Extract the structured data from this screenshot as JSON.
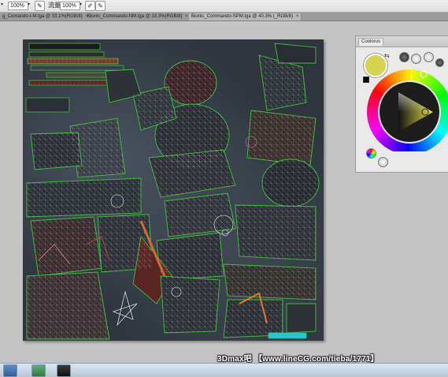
{
  "options_bar": {
    "zoom_value_1": "100%",
    "flow_label": "流量:",
    "zoom_value_2": "100%"
  },
  "doc_tabs": [
    {
      "label": "g_Comando-I-M.tga @ 33.1%(RGB/8)",
      "close": "×"
    },
    {
      "label": "Bionic_Commando-NM.tga @ 33.3%(RGB/8)",
      "close": "×"
    },
    {
      "label": "Bionic_Commando-SPM.tga @ 40.3% (_RGB/8)",
      "close": "×"
    }
  ],
  "color_panel": {
    "title": "Coolorus",
    "current_color": "#d4d44f"
  },
  "watermark": {
    "text": "3Dmax吧 【www.lineCG.com/tieba/1771】"
  },
  "icons": [
    "brush-tool-icon",
    "airbrush-icon",
    "color-wheel",
    "swap-colors-icon",
    "reset-colors-icon",
    "palette-icon"
  ]
}
